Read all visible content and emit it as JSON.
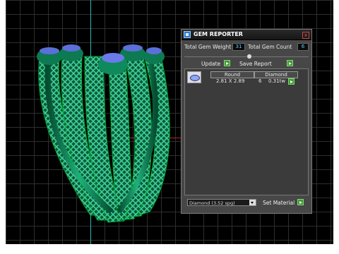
{
  "panel": {
    "title": "GEM REPORTER",
    "close_glyph": "x",
    "total_weight_label": "Total Gem Weight",
    "total_weight_value": "31",
    "total_count_label": "Total Gem Count",
    "total_count_value": "6",
    "update_label": "Update",
    "save_report_label": "Save Report",
    "columns": [
      "Round",
      "Diamond"
    ],
    "row": {
      "size": "2.81 X 2.89",
      "count": "6",
      "weight": "0.31tw"
    },
    "material_select": "Diamond   (3.52 spg)",
    "set_material_label": "Set Material"
  },
  "icons": {
    "app": "gem-reporter-icon",
    "close": "close-icon",
    "go": "play-arrow-icon",
    "gem": "round-gem-icon",
    "dropdown": "chevron-down-icon"
  },
  "colors": {
    "viewport_bg": "#000000",
    "ring_green": "#0e8a5a",
    "value_cyan": "#5fd0ff",
    "button_green": "#3a9d2f"
  }
}
